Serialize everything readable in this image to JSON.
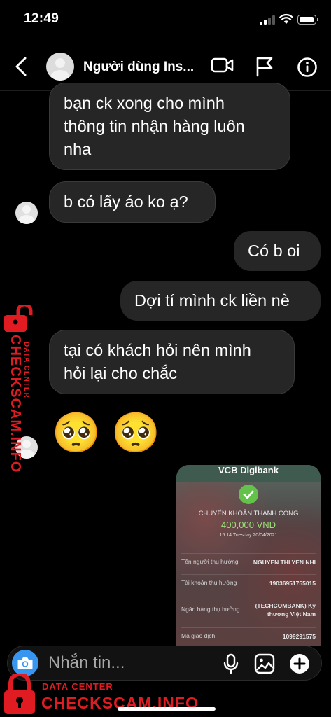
{
  "status_bar": {
    "time": "12:49"
  },
  "header": {
    "contact_name": "Người dùng Ins..."
  },
  "messages": [
    {
      "direction": "in",
      "text": "bạn ck xong cho mình\nthông tin nhận hàng luôn\nnha"
    },
    {
      "direction": "in",
      "text": "b có lấy áo ko ạ?"
    },
    {
      "direction": "out",
      "text": "Có b oi"
    },
    {
      "direction": "out",
      "text": "Dợi tí mình ck liền nè"
    },
    {
      "direction": "in",
      "text": "tại có khách hỏi nên mình\nhỏi lại cho chắc"
    },
    {
      "direction": "in",
      "text": "🥺 🥺"
    }
  ],
  "receipt": {
    "brand": "VCB Digibank",
    "title": "CHUYỂN KHOẢN THÀNH CÔNG",
    "amount": "400,000 VND",
    "datetime": "16:14 Tuesday 20/04/2021",
    "rows": [
      {
        "label": "Tên người thụ hưởng",
        "value": "NGUYEN THI YEN NHI"
      },
      {
        "label": "Tài khoản thụ hưởng",
        "value": "19036951755015"
      },
      {
        "label": "Ngân hàng thụ hưởng",
        "value": "(TECHCOMBANK) Kỹ\nthương Việt Nam"
      },
      {
        "label": "Mã giao dịch",
        "value": "1099291575"
      }
    ]
  },
  "composer": {
    "placeholder": "Nhắn tin..."
  },
  "watermark": {
    "sub": "DATA CENTER",
    "main": "CHECKSCAM.INFO"
  },
  "colors": {
    "accent_blue": "#3797f0",
    "bubble": "#262626",
    "watermark_red": "#e01b22",
    "success_green": "#62c24a"
  }
}
